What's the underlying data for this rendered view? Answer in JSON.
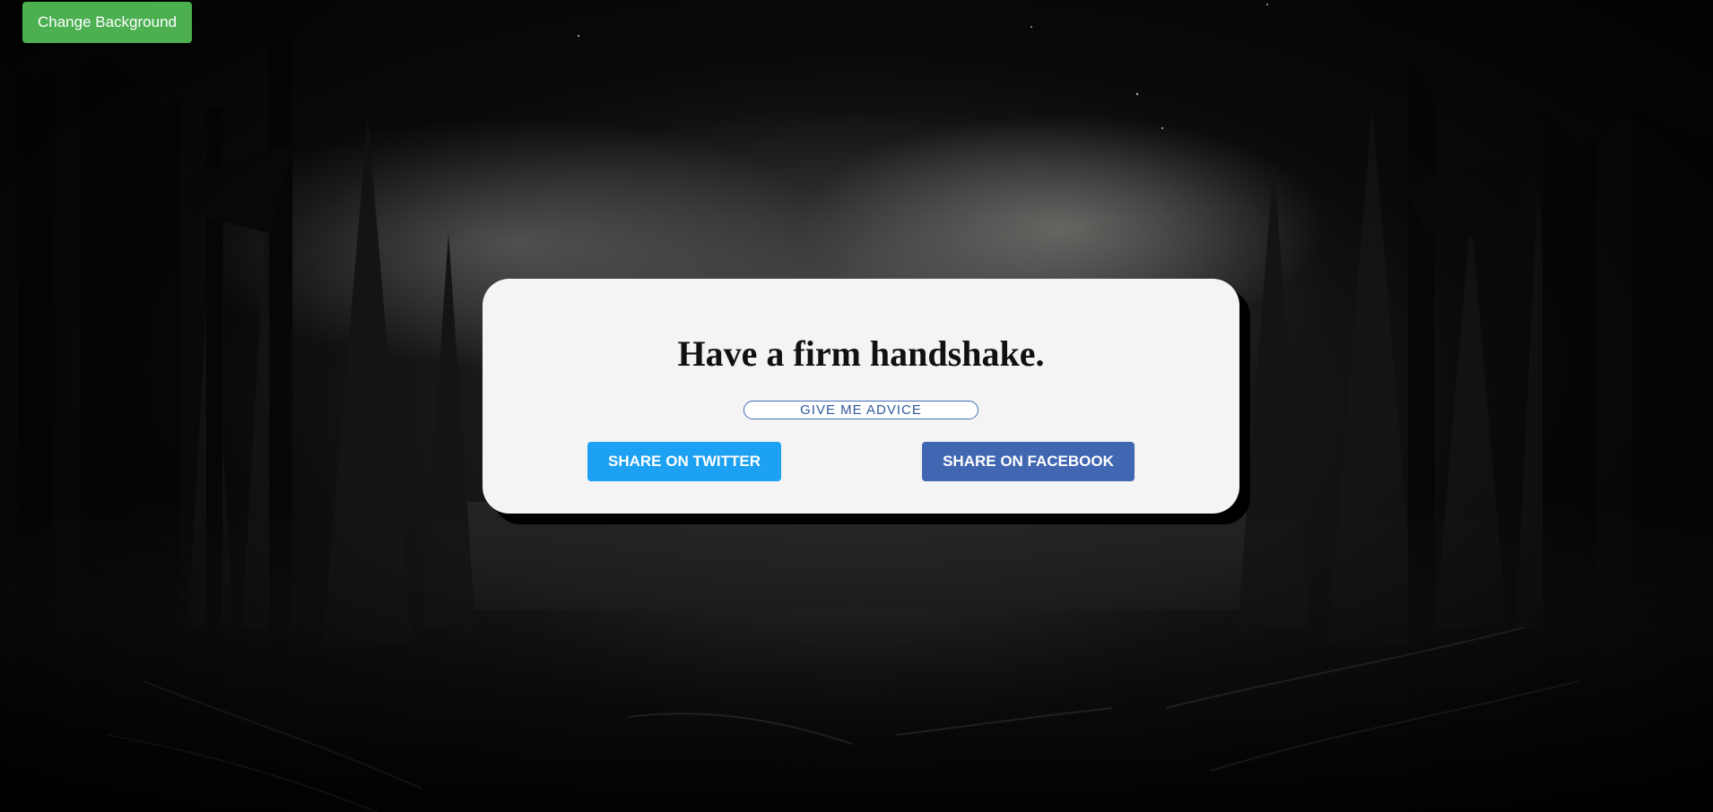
{
  "background": {
    "change_label": "Change Background",
    "button_color": "#4caf50"
  },
  "card": {
    "quote": "Have a firm handshake.",
    "advice_label": "GIVE ME ADVICE",
    "twitter_label": "SHARE ON TWITTER",
    "facebook_label": "SHARE ON FACEBOOK",
    "twitter_color": "#1da1f2",
    "facebook_color": "#4267b2"
  }
}
